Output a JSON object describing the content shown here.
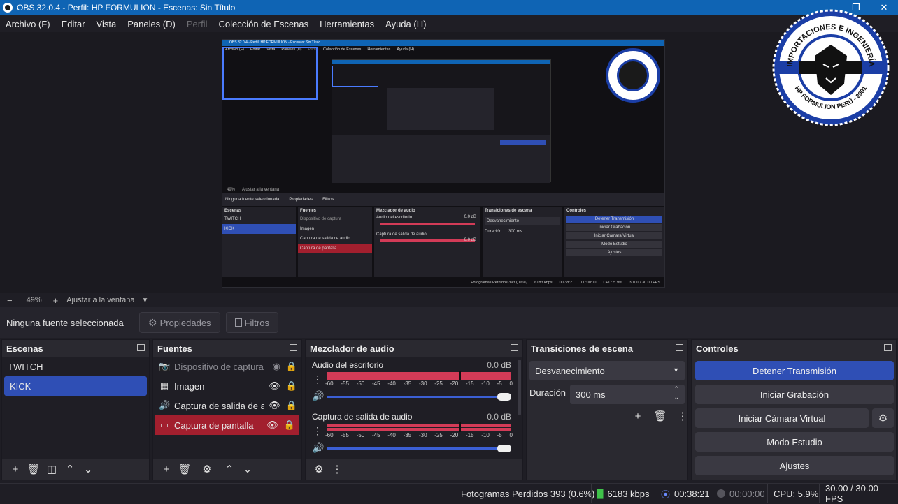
{
  "window": {
    "title": "OBS 32.0.4 - Perfil: HP FORMULION - Escenas: Sin Título"
  },
  "menu": [
    {
      "label": "Archivo (F)",
      "enabled": true
    },
    {
      "label": "Editar",
      "enabled": true
    },
    {
      "label": "Vista",
      "enabled": true
    },
    {
      "label": "Paneles (D)",
      "enabled": true
    },
    {
      "label": "Perfil",
      "enabled": false
    },
    {
      "label": "Colección de Escenas",
      "enabled": true
    },
    {
      "label": "Herramientas",
      "enabled": true
    },
    {
      "label": "Ayuda (H)",
      "enabled": true
    }
  ],
  "logo": {
    "top_text": "IMPORTACIONES E INGENIERÍA",
    "bottom_text": "HP FORMULION PERÚ - 2001"
  },
  "zoom": {
    "minus": "−",
    "value": "49%",
    "plus": "+",
    "fit_label": "Ajustar a la ventana"
  },
  "context": {
    "selection": "Ninguna fuente seleccionada",
    "properties": "Propiedades",
    "filters": "Filtros"
  },
  "scenes": {
    "title": "Escenas",
    "items": [
      "TWITCH",
      "KICK"
    ],
    "selected_index": 1
  },
  "sources": {
    "title": "Fuentes",
    "items": [
      {
        "label": "Dispositivo de captura",
        "icon": "camera-icon",
        "dim": true
      },
      {
        "label": "Imagen",
        "icon": "image-icon",
        "dim": false
      },
      {
        "label": "Captura de salida de audio",
        "icon": "speaker-icon",
        "dim": false
      },
      {
        "label": "Captura de pantalla",
        "icon": "monitor-icon",
        "dim": false,
        "selected": true
      }
    ]
  },
  "mixer": {
    "title": "Mezclador de audio",
    "channels": [
      {
        "name": "Audio del escritorio",
        "db": "0.0 dB"
      },
      {
        "name": "Captura de salida de audio",
        "db": "0.0 dB"
      }
    ],
    "ticks": [
      "-60",
      "-55",
      "-50",
      "-45",
      "-40",
      "-35",
      "-30",
      "-25",
      "-20",
      "-15",
      "-10",
      "-5",
      "0"
    ]
  },
  "transitions": {
    "title": "Transiciones de escena",
    "selected": "Desvanecimiento",
    "duration_label": "Duración",
    "duration_value": "300 ms"
  },
  "controls": {
    "title": "Controles",
    "stop_stream": "Detener Transmisión",
    "start_recording": "Iniciar Grabación",
    "virtual_cam": "Iniciar Cámara Virtual",
    "studio_mode": "Modo Estudio",
    "settings": "Ajustes"
  },
  "status": {
    "dropped": "Fotogramas Perdidos 393 (0.6%)",
    "bitrate": "6183 kbps",
    "stream_time": "00:38:21",
    "rec_time": "00:00:00",
    "cpu": "CPU: 5.9%",
    "fps": "30.00 / 30.00 FPS"
  },
  "colors": {
    "accent": "#2f4fb5",
    "titlebar": "#0f64b4",
    "meter": "#d33b57",
    "source_selected": "#a21f2e"
  },
  "preview_text": {
    "title": "OBS 32.0.4 - Perfil: HP FORMULION - Escenas: Sin Título",
    "menu": [
      "Archivo (F)",
      "Editar",
      "Vista",
      "Paneles (D)",
      "Perfil",
      "Colección de Escenas",
      "Herramientas",
      "Ayuda (H)"
    ],
    "zoom": "49%",
    "fit": "Ajustar a la ventana",
    "selection": "Ninguna fuente seleccionada",
    "properties": "Propiedades",
    "filters": "Filtros",
    "docks": [
      "Escenas",
      "Fuentes",
      "Mezclador de audio",
      "Transiciones de escena",
      "Controles"
    ],
    "scenes": [
      "TWITCH",
      "KICK"
    ],
    "sources": [
      "Dispositivo de captura",
      "Imagen",
      "Captura de salida de audio",
      "Captura de pantalla"
    ],
    "mixer": [
      "Audio del escritorio",
      "Captura de salida de audio"
    ],
    "db": "0.0 dB",
    "transition": "Desvanecimiento",
    "duration": "Duración",
    "duration_value": "300 ms",
    "controls": [
      "Detener Transmisión",
      "Iniciar Grabación",
      "Iniciar Cámara Virtual",
      "Modo Estudio",
      "Ajustes"
    ],
    "status": [
      "Fotogramas Perdidos 393 (0.6%)",
      "6183 kbps",
      "00:38:21",
      "00:00:00",
      "CPU: 5.9%",
      "30.00 / 30.00 FPS"
    ]
  }
}
